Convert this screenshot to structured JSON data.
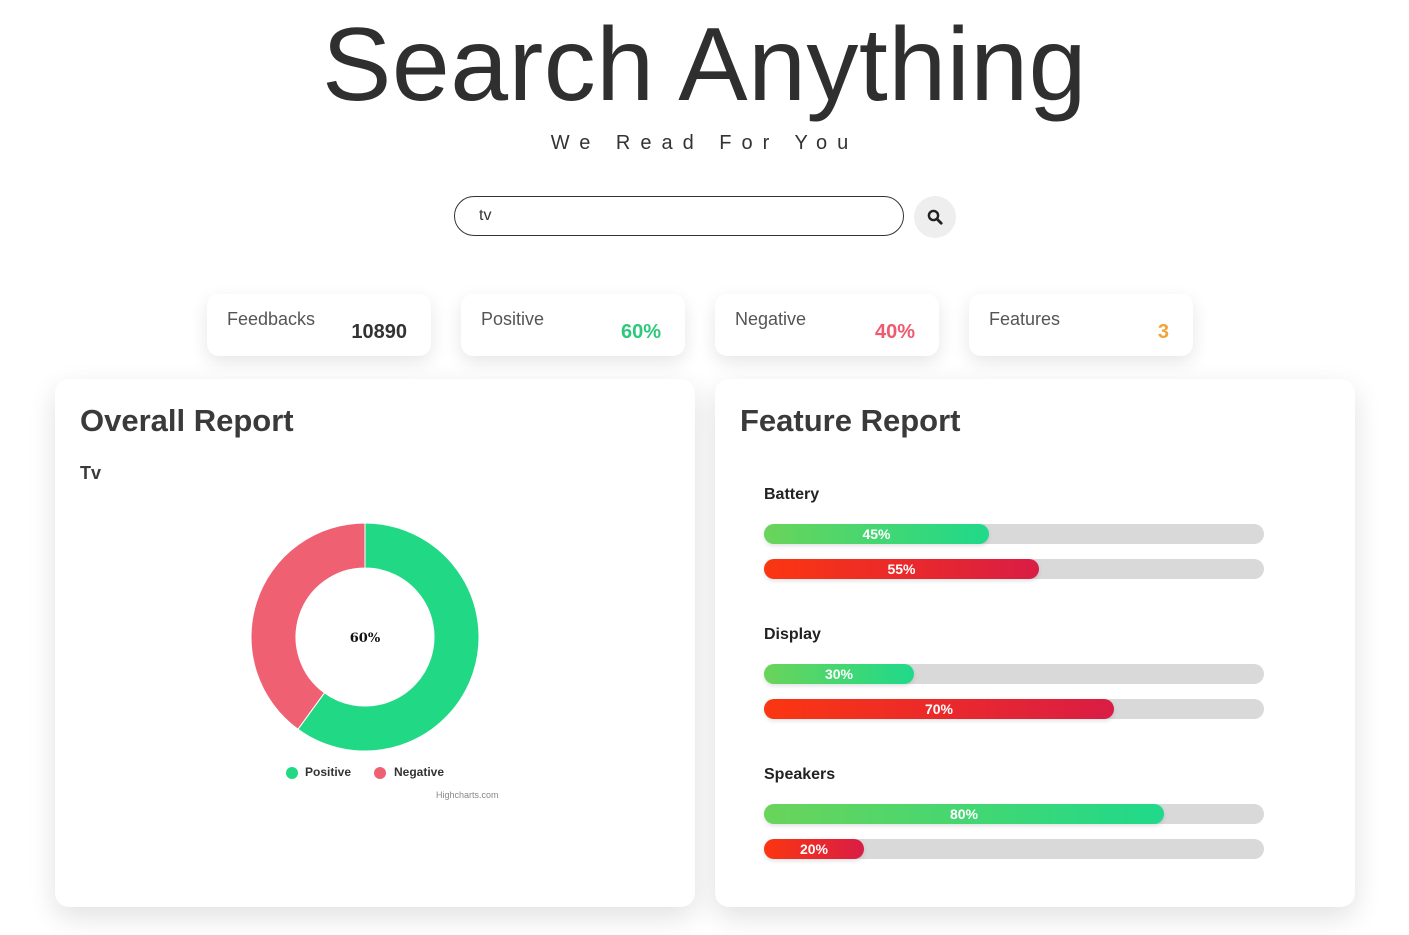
{
  "header": {
    "title": "Search Anything",
    "subtitle": "We Read For You"
  },
  "search": {
    "value": "tv",
    "button_icon": "search-icon"
  },
  "stats": [
    {
      "label": "Feedbacks",
      "value": "10890",
      "color": "#333333"
    },
    {
      "label": "Positive",
      "value": "60%",
      "color": "#2dc97b"
    },
    {
      "label": "Negative",
      "value": "40%",
      "color": "#ef5a6f"
    },
    {
      "label": "Features",
      "value": "3",
      "color": "#f0a43a"
    }
  ],
  "overall_report": {
    "title": "Overall Report",
    "center_label": "60%",
    "credits": "Highcharts.com",
    "chart_data": {
      "type": "pie",
      "title": "Tv",
      "donut": true,
      "slices": [
        {
          "name": "Positive",
          "value": 60,
          "color": "#21d985"
        },
        {
          "name": "Negative",
          "value": 40,
          "color": "#f06073"
        }
      ],
      "legend": "bottom"
    }
  },
  "feature_report": {
    "title": "Feature Report",
    "features": [
      {
        "name": "Battery",
        "positive": 45,
        "negative": 55,
        "positive_label": "45%",
        "negative_label": "55%"
      },
      {
        "name": "Display",
        "positive": 30,
        "negative": 70,
        "positive_label": "30%",
        "negative_label": "70%"
      },
      {
        "name": "Speakers",
        "positive": 80,
        "negative": 20,
        "positive_label": "80%",
        "negative_label": "20%"
      }
    ]
  }
}
